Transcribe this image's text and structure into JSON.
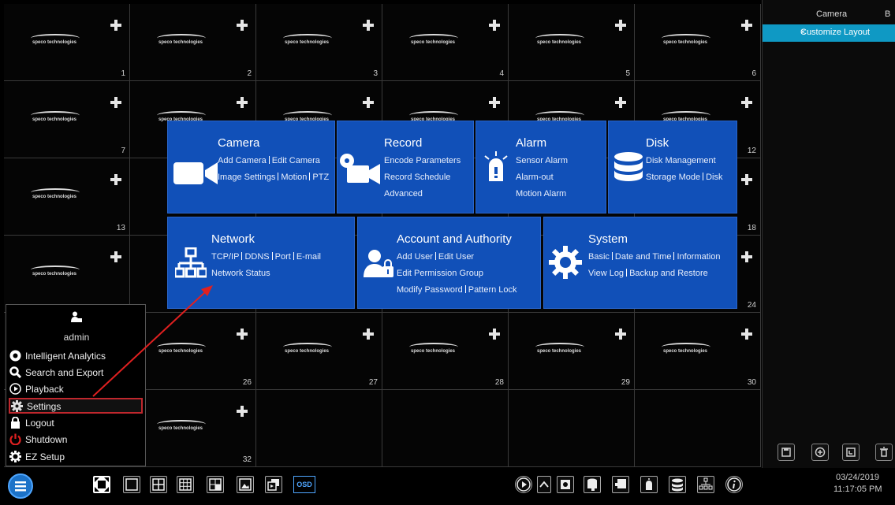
{
  "logo_text": "speco technologies",
  "channels": [
    "1",
    "2",
    "3",
    "4",
    "5",
    "6",
    "7",
    "12",
    "13",
    "18",
    "24",
    "26",
    "27",
    "28",
    "29",
    "30",
    "32"
  ],
  "settings_tiles": {
    "camera": {
      "title": "Camera",
      "links": [
        "Add Camera",
        "Edit Camera",
        "Image Settings",
        "Motion",
        "PTZ"
      ],
      "icon": "video-camera-icon"
    },
    "record": {
      "title": "Record",
      "links": [
        "Encode Parameters",
        "Record Schedule",
        "Advanced"
      ],
      "icon": "record-camera-icon"
    },
    "alarm": {
      "title": "Alarm",
      "links": [
        "Sensor Alarm",
        "Alarm-out",
        "Motion Alarm"
      ],
      "icon": "alarm-light-icon"
    },
    "disk": {
      "title": "Disk",
      "links": [
        "Disk Management",
        "Storage Mode",
        "Disk"
      ],
      "icon": "disk-stack-icon"
    },
    "network": {
      "title": "Network",
      "links": [
        "TCP/IP",
        "DDNS",
        "Port",
        "E-mail",
        "Network Status"
      ],
      "icon": "network-tree-icon"
    },
    "account": {
      "title": "Account and Authority",
      "links": [
        "Add User",
        "Edit User",
        "Edit Permission Group",
        "Modify Password",
        "Pattern Lock"
      ],
      "icon": "user-lock-icon"
    },
    "system": {
      "title": "System",
      "links": [
        "Basic",
        "Date and Time",
        "Information",
        "View Log",
        "Backup and Restore"
      ],
      "icon": "gear-icon"
    }
  },
  "right_panel": {
    "header": "Camera",
    "header_right": "B",
    "layout_button": "Customize Layout",
    "close": "×"
  },
  "start_menu": {
    "username": "admin",
    "items": [
      {
        "label": "Intelligent Analytics",
        "icon": "analytics-icon"
      },
      {
        "label": "Search and Export",
        "icon": "search-icon"
      },
      {
        "label": "Playback",
        "icon": "playback-icon"
      },
      {
        "label": "Settings",
        "icon": "gear-icon"
      },
      {
        "label": "Logout",
        "icon": "lock-icon"
      },
      {
        "label": "Shutdown",
        "icon": "power-icon"
      },
      {
        "label": "EZ Setup",
        "icon": "ez-setup-icon"
      }
    ]
  },
  "taskbar": {
    "osd": "OSD",
    "date": "03/24/2019",
    "time": "11:17:05 PM"
  },
  "colors": {
    "tile_blue": "#1150b8",
    "accent_cyan": "#0f99c4",
    "highlight_red": "#c0272d",
    "arrow_red": "#e02020"
  }
}
